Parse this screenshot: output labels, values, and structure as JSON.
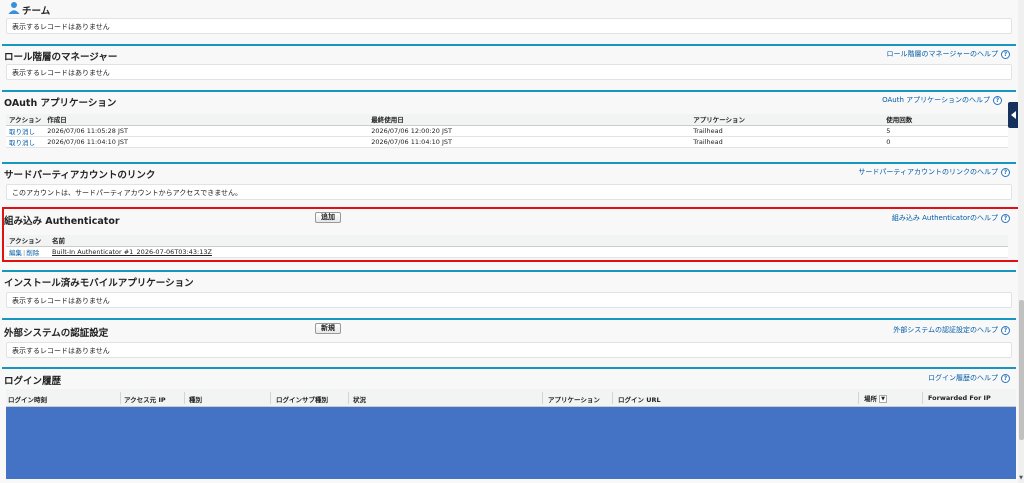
{
  "sections": {
    "team": {
      "title": "チーム",
      "empty": "表示するレコードはありません"
    },
    "role_managers": {
      "title": "ロール階層のマネージャー",
      "help": "ロール階層のマネージャーのヘルプ",
      "empty": "表示するレコードはありません"
    },
    "oauth": {
      "title": "OAuth アプリケーション",
      "help": "OAuth アプリケーションのヘルプ",
      "columns": [
        "アクション",
        "作成日",
        "最終使用日",
        "アプリケーション",
        "使用回数"
      ],
      "rows": [
        {
          "action": "取り消し",
          "created": "2026/07/06 11:05:28 JST",
          "last_used": "2026/07/06 12:00:20 JST",
          "app": "Trailhead",
          "count": "5"
        },
        {
          "action": "取り消し",
          "created": "2026/07/06 11:04:10 JST",
          "last_used": "2026/07/06 11:04:10 JST",
          "app": "Trailhead",
          "count": "0"
        }
      ]
    },
    "third_party": {
      "title": "サードパーティアカウントのリンク",
      "help": "サードパーティアカウントのリンクのヘルプ",
      "message": "このアカウントは、サードパーティアカウントからアクセスできません。"
    },
    "authenticator": {
      "title": "組み込み Authenticator",
      "add_button": "追加",
      "help": "組み込み Authenticatorのヘルプ",
      "columns": [
        "アクション",
        "名前"
      ],
      "row": {
        "edit": "編集",
        "sep": "|",
        "delete": "削除",
        "name": "Built-In Authenticator #1_2026-07-06T03:43:13Z"
      }
    },
    "mobile_apps": {
      "title": "インストール済みモバイルアプリケーション",
      "empty": "表示するレコードはありません"
    },
    "external_auth": {
      "title": "外部システムの認証設定",
      "new_button": "新規",
      "help": "外部システムの認証設定のヘルプ",
      "empty": "表示するレコードはありません"
    },
    "login_history": {
      "title": "ログイン履歴",
      "help": "ログイン履歴のヘルプ",
      "columns": [
        "ログイン時刻",
        "アクセス元 IP",
        "種別",
        "ログインサブ種別",
        "状況",
        "アプリケーション",
        "ログイン URL",
        "場所",
        "Forwarded For IP"
      ]
    }
  },
  "help_icon_glyph": "?",
  "colors": {
    "section_border": "#1797c0",
    "link": "#015ba7",
    "highlight": "#e01111",
    "login_fill": "#4472c4"
  }
}
